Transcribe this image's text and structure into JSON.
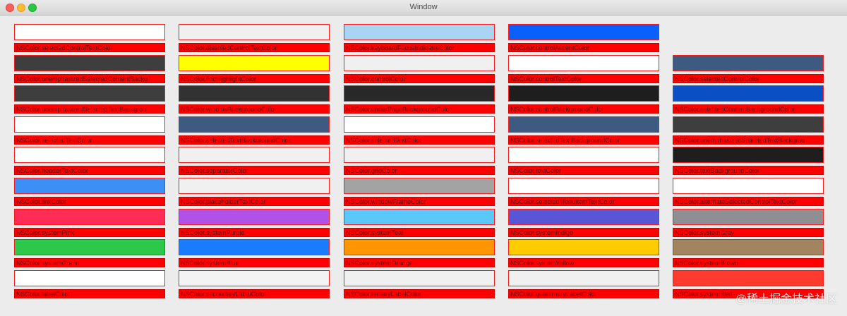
{
  "window": {
    "title": "Window"
  },
  "columns": [
    {
      "items": [
        {
          "name": "NSColor.selectedControlTextColor",
          "color": "#ffffff"
        },
        {
          "name": "NSColor.unemphasizedSelectedContentBackg",
          "color": "#3e3e3e"
        },
        {
          "name": "NSColor.unemphasizedSelectedTextBackgrou",
          "color": "#3e3e3e"
        },
        {
          "name": "NSColor.selectedTextColor",
          "color": "#ffffff"
        },
        {
          "name": "NSColor.headerTextColor",
          "color": "#ffffff"
        },
        {
          "name": "NSColor.linkColor",
          "color": "#3b8ff5"
        },
        {
          "name": "NSColor.systemPink",
          "color": "#ff2d55"
        },
        {
          "name": "NSColor.systemGreen",
          "color": "#2cc84a"
        },
        {
          "name": "NSColor.labelColor",
          "color": "#ffffff"
        }
      ]
    },
    {
      "items": [
        {
          "name": "NSColor.disabledControlTextColor",
          "color": "#f0f0f0"
        },
        {
          "name": "NSColor.findHighlightColor",
          "color": "#ffff00"
        },
        {
          "name": "NSColor.windowBackgroundColor",
          "color": "#323232"
        },
        {
          "name": "NSColor.selectedTextBackgroundColor",
          "color": "#3f5a80"
        },
        {
          "name": "NSColor.separatorColor",
          "color": "#f0f0f0"
        },
        {
          "name": "NSColor.placeholderTextColor",
          "color": "#f0f0f0"
        },
        {
          "name": "NSColor.systemPurple",
          "color": "#b052e7"
        },
        {
          "name": "NSColor.systemBlue",
          "color": "#1a7bff"
        },
        {
          "name": "NSColor.secondaryLabelColor",
          "color": "#f3f3f3"
        }
      ]
    },
    {
      "items": [
        {
          "name": "NSColor.keyboardFocusIndicatorColor",
          "color": "#a9d4f2"
        },
        {
          "name": "NSColor.controlColor",
          "color": "#f0f0f0"
        },
        {
          "name": "NSColor.underPageBackgroundColor",
          "color": "#282828"
        },
        {
          "name": "NSColor.selectedTextColor",
          "color": "#ffffff"
        },
        {
          "name": "NSColor.gridColor",
          "color": "#f0f0f0"
        },
        {
          "name": "NSColor.windowFrameColor",
          "color": "#a3a3a3"
        },
        {
          "name": "NSColor.systemTeal",
          "color": "#5ac8fa"
        },
        {
          "name": "NSColor.systemOrange",
          "color": "#ff9500"
        },
        {
          "name": "NSColor.tertiaryLabelColor",
          "color": "#f0f0f0"
        }
      ]
    },
    {
      "items": [
        {
          "name": "NSColor.controlAccentColor",
          "color": "#0a60ff"
        },
        {
          "name": "NSColor.controlTextColor",
          "color": "#ffffff"
        },
        {
          "name": "NSColor.controlBackgroundColor",
          "color": "#1e1e1e"
        },
        {
          "name": "NSColor.selectedTextBackgroundColor",
          "color": "#3f5a80"
        },
        {
          "name": "NSColor.textColor",
          "color": "#ffffff"
        },
        {
          "name": "NSColor.selectedMenuItemTextColor",
          "color": "#ffffff"
        },
        {
          "name": "NSColor.systemIndigo",
          "color": "#5856d6"
        },
        {
          "name": "NSColor.systemYellow",
          "color": "#ffcc00"
        },
        {
          "name": "NSColor.quaternaryLabelColor",
          "color": "#f0f0f0"
        }
      ]
    },
    {
      "items": [
        {
          "name": "NSColor.selectedControlColor",
          "color": "#3f5a80"
        },
        {
          "name": "NSColor.selectedContentBackgroundColor",
          "color": "#0a4fc4"
        },
        {
          "name": "NSColor.unemphasizedSelectedTextBackgrou",
          "color": "#3e3e3e"
        },
        {
          "name": "NSColor.textBackgroundColor",
          "color": "#1e1e1e"
        },
        {
          "name": "NSColor.alternateSelectedControlTextColor",
          "color": "#ffffff"
        },
        {
          "name": "NSColor.systemGray",
          "color": "#8e8e93"
        },
        {
          "name": "NSColor.systemBrown",
          "color": "#a2845e"
        },
        {
          "name": "NSColor.systemRed",
          "color": "#ff3b30"
        }
      ]
    }
  ],
  "watermark": "@稀土掘金技术社区"
}
